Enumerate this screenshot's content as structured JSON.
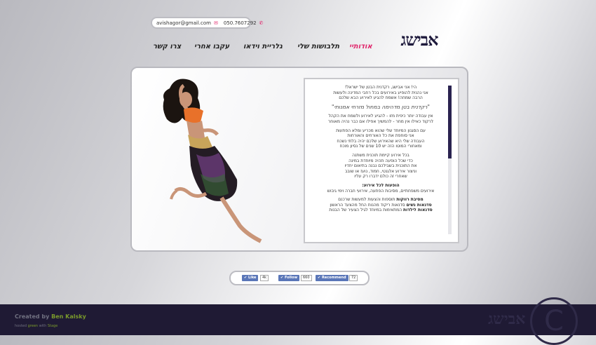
{
  "header": {
    "contact_email": "avishagor@gmail.com",
    "contact_phone": "050.7607292",
    "logo": "אבישג"
  },
  "nav": {
    "items": [
      {
        "label": "אודותיי",
        "active": true
      },
      {
        "label": "תלבושות שלי",
        "active": false
      },
      {
        "label": "גלריית וידאו",
        "active": false
      },
      {
        "label": "עקבו אחרי",
        "active": false
      },
      {
        "label": "צרו קשר",
        "active": false
      }
    ]
  },
  "content": {
    "p1": [
      "הי! אני אבישג, רקדנית הבטן של ישראל!",
      "אני נהנית להופיע באירועים בכל רחבי המדינה ולעשות",
      "הרבה שמחה! אשמח להגיע לאירוע הבא שלכם"
    ],
    "quote": "\"רקדנית בטן מדהימה במחול מזרחי אמנותי\"",
    "p2": [
      "אין עבודה יותר כיפית מזו - להגיע לאירוע ולשמח את הקהל",
      "לרקוד כאילו אין מחר - להמשיך אפילו אם כבר נהיה מאוחר"
    ],
    "p3": [
      "עם הסגנון המיוחד שלי שהוא מכריע ומלא הפתעות",
      "אני סוחפת את כל האורחים והאורחות",
      "העבודה שלי היא שהאירוע שלכם יהיה בלתי נשכח",
      "ומאחורי המוטו הזה יש 10 שנים של נסיון מוכח"
    ],
    "p4": [
      "בכל אירוע קיימת תוכנית משתנה",
      "כדי שכל הופעה תהיה מיוחדת במינה",
      "את התוכנית בשבילכם נבנה בתיאום יחדיו",
      "וניצור אירוע אלגנטי, חמוד, נועז או שובב",
      "שאחרי זה כולם ידברו רק עליו"
    ],
    "p5_title": "הופעות לכל אירוע:",
    "p5_line": "אירועים משפחתיים, מסיבות הפתעה, אירועי חברה וימי גיבוש",
    "p6": [
      {
        "bold": "מסיבת רווקות",
        "text": " תוספות והצעות למעשות שרכנם"
      },
      {
        "bold": "סדנאות נשים",
        "text": " סדנאות ריקוד מהנות החל מהצעד הראשון"
      },
      {
        "bold": "סדנאות לילדות",
        "text": " המתאימות במיוחד לגיל הצעיר של הבנות"
      }
    ]
  },
  "social": {
    "like_label": "Like",
    "like_count": "4k",
    "follow_label": "Follow",
    "follow_count": "660",
    "recommend_label": "Recommend",
    "recommend_count": "72"
  },
  "footer": {
    "created_prefix": "Created by ",
    "created_name": "Ben Kalsky",
    "host_prefix": "hosted ",
    "host_mid1": "green",
    "host_mid2": " with ",
    "host_end": "Stage",
    "logo": "אבישג",
    "copyright": "C"
  },
  "colors": {
    "accent": "#e0246a",
    "dark": "#1f1a34",
    "social_blue": "#5a76b8"
  }
}
